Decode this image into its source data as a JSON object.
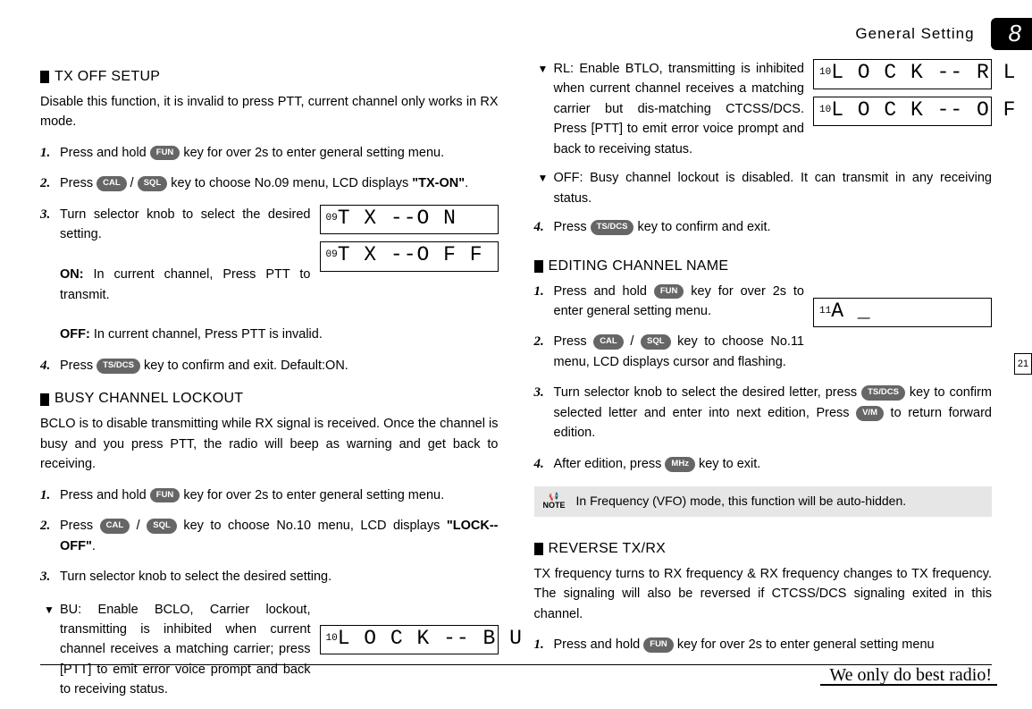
{
  "header": {
    "title": "General Setting",
    "chapter": "8"
  },
  "side_page": "21",
  "footer": {
    "slogan": "We only do best radio!"
  },
  "sec1": {
    "title": "TX OFF SETUP",
    "intro": "Disable this function, it is invalid to press PTT, current channel only works in RX mode.",
    "s1a": "Press and hold ",
    "s1b": " key for over 2s to enter general setting menu.",
    "s2a": "Press ",
    "s2b": " key to choose No.09 menu, LCD displays ",
    "s2c": "\"TX-ON\"",
    "s2d": ".",
    "s3a": "Turn selector knob to select the desired setting.",
    "s3b_label": "ON:",
    "s3b": " In current channel, Press PTT to transmit.",
    "s3c_label": "OFF:",
    "s3c": " In current channel, Press PTT is invalid.",
    "s4a": "Press ",
    "s4b": " key to confirm and exit. Default:ON.",
    "lcd1_pre": "09",
    "lcd1": "T X --O N",
    "lcd2_pre": "09",
    "lcd2": "T X --O F F"
  },
  "sec2": {
    "title": "BUSY CHANNEL LOCKOUT",
    "intro": "BCLO is to disable transmitting while RX signal is received. Once the channel is busy and you press PTT, the radio will beep as warning and get back to receiving.",
    "s1a": "Press and hold ",
    "s1b": " key for over 2s to enter general setting menu.",
    "s2": "Press ",
    "s2b": " key to choose No.10 menu, LCD displays ",
    "s2c": "\"LOCK--OFF\"",
    "s2d": ".",
    "s3": "Turn selector knob to select the desired setting.",
    "bu1": "BU: Enable BCLO, Carrier lockout, transmitting is inhibited when current channel receives a matching carrier; press [PTT] to emit error voice prompt and back to receiving status.",
    "lcd3_pre": "10",
    "lcd3": "L O C K -- B U",
    "rl1": "RL: Enable BTLO, transmitting is inhibited when current channel receives a matching carrier but dis-matching CTCSS/DCS. Press [PTT] to emit error voice prompt and back to receiving status.",
    "off1": "OFF: Busy channel lockout is disabled. It can transmit in any receiving status.",
    "lcd4_pre": "10",
    "lcd4": "L O C K -- R L",
    "lcd5_pre": "10",
    "lcd5": "L O C K -- O F",
    "s4a": "Press ",
    "s4b": " key to confirm and exit."
  },
  "sec3": {
    "title": "EDITING CHANNEL NAME",
    "s1a": "Press and hold ",
    "s1b": " key for over 2s to enter general setting menu.",
    "s2a": "Press ",
    "s2b": " key to choose No.11 menu, LCD displays cursor and flashing.",
    "s3a": "Turn selector knob to select the desired letter, press ",
    "s3b": " key to confirm selected letter and enter into next edition, Press ",
    "s3c": " to return forward edition.",
    "s4a": "After edition, press ",
    "s4b": " key to exit.",
    "lcd6_pre": "11",
    "lcd6": "A _",
    "note": "In Frequency (VFO) mode, this function will be auto-hidden.",
    "note_label": "NOTE"
  },
  "sec4": {
    "title": "REVERSE TX/RX",
    "intro": "TX frequency turns to RX frequency & RX frequency changes to TX frequency. The signaling will also be reversed if CTCSS/DCS signaling exited in this channel.",
    "s1a": "Press and hold ",
    "s1b": " key for over 2s to enter general setting menu"
  },
  "keys": {
    "fun": "FUN",
    "cal": "CAL",
    "sql": "SQL",
    "tsdcs": "TS/DCS",
    "vm": "V/M",
    "mhz": "MHz"
  }
}
